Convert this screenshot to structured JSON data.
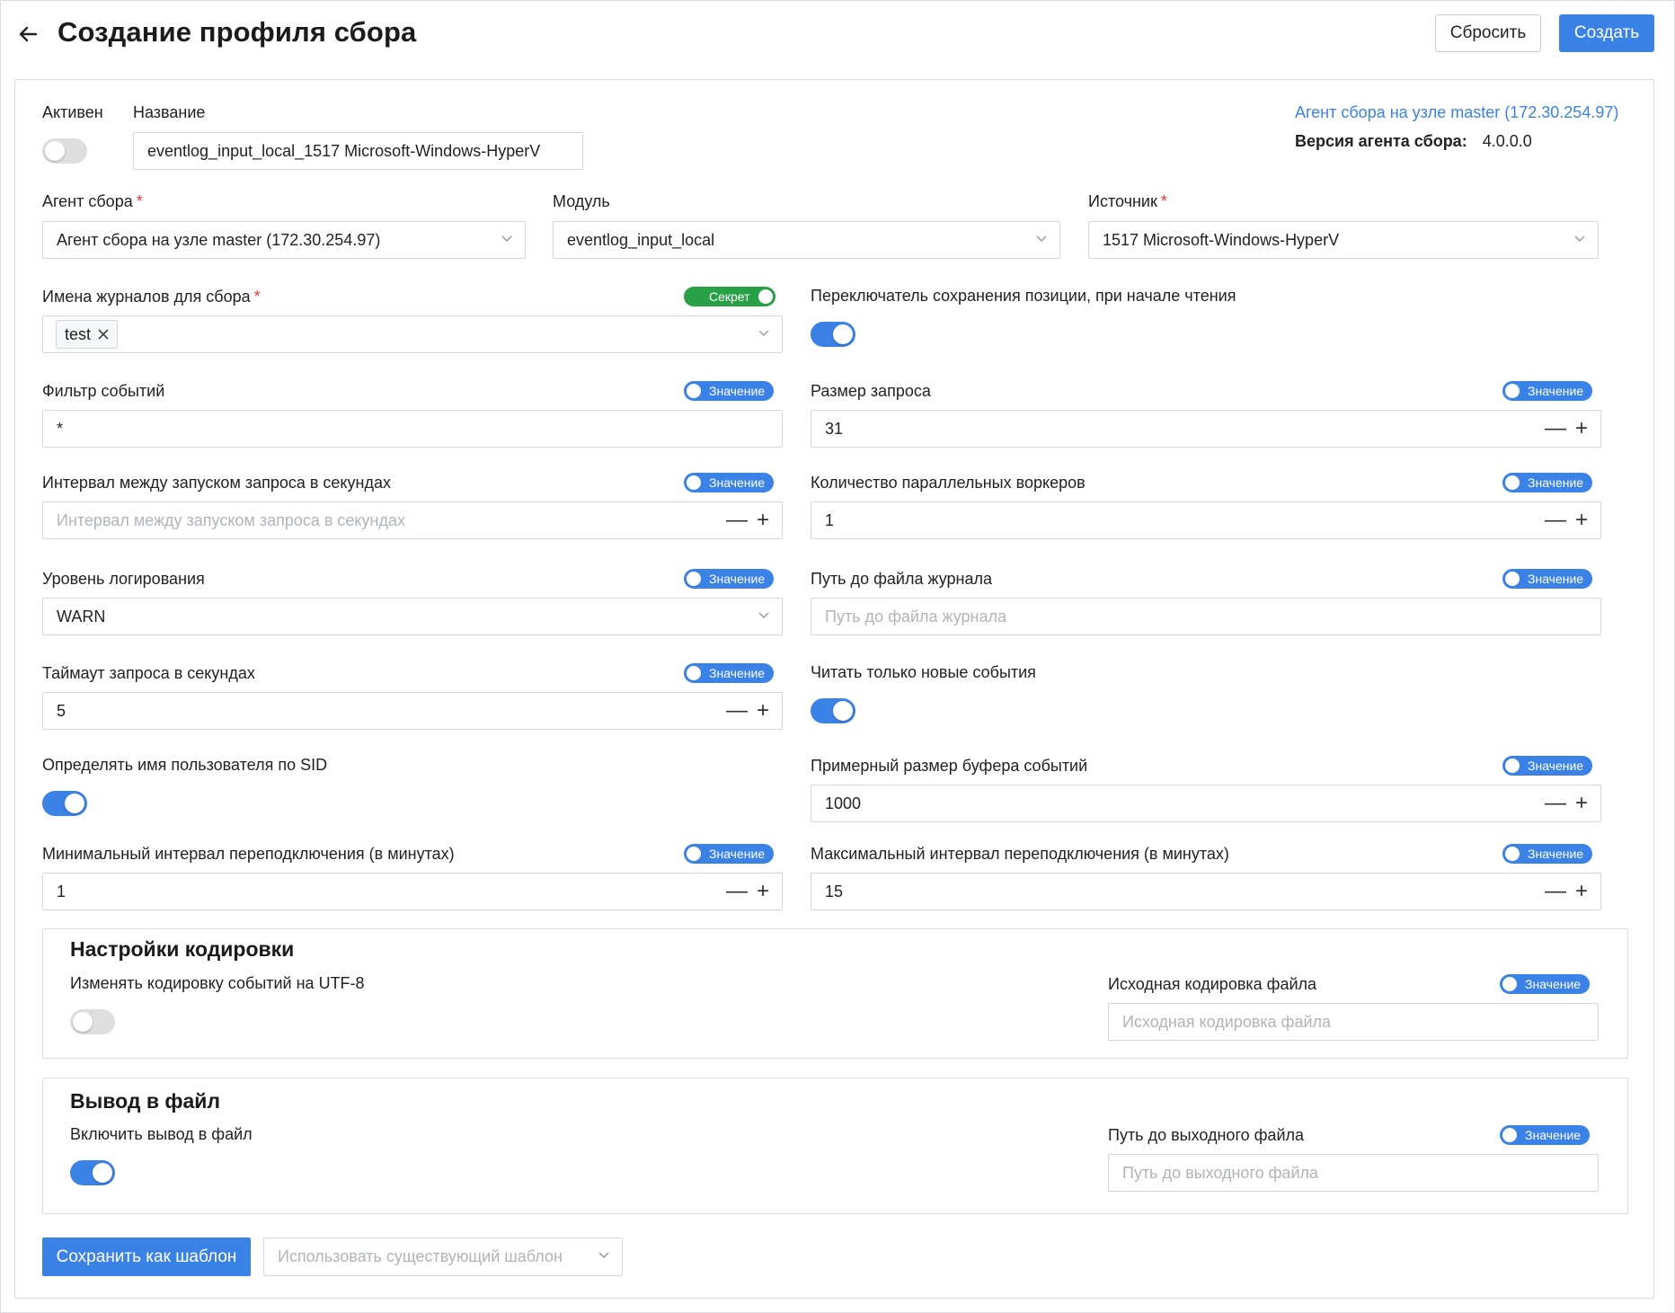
{
  "header": {
    "title": "Создание профиля сбора",
    "reset_label": "Сбросить",
    "create_label": "Создать"
  },
  "top": {
    "active_label": "Активен",
    "active_on": false,
    "name_label": "Название",
    "name_value": "eventlog_input_local_1517 Microsoft-Windows-HyperV",
    "agent_link": "Агент сбора на узле master (172.30.254.97)",
    "agent_version_label": "Версия агента сбора:",
    "agent_version_value": "4.0.0.0"
  },
  "selects": {
    "agent_label": "Агент сбора",
    "agent_value": "Агент сбора на узле master (172.30.254.97)",
    "module_label": "Модуль",
    "module_value": "eventlog_input_local",
    "source_label": "Источник",
    "source_value": "1517 Microsoft-Windows-HyperV"
  },
  "pills": {
    "value": "Значение",
    "secret": "Секрет"
  },
  "fields": {
    "journals_label": "Имена журналов для сбора",
    "journals_tag": "test",
    "save_pos_label": "Переключатель сохранения позиции, при начале чтения",
    "save_pos_on": true,
    "filter_label": "Фильтр событий",
    "filter_value": "*",
    "req_size_label": "Размер запроса",
    "req_size_value": "31",
    "interval_label": "Интервал между запуском запроса в секундах",
    "interval_placeholder": "Интервал между запуском запроса в секундах",
    "workers_label": "Количество параллельных воркеров",
    "workers_value": "1",
    "log_level_label": "Уровень логирования",
    "log_level_value": "WARN",
    "log_path_label": "Путь до файла журнала",
    "log_path_placeholder": "Путь до файла журнала",
    "timeout_label": "Таймаут запроса в секундах",
    "timeout_value": "5",
    "new_only_label": "Читать только новые события",
    "new_only_on": true,
    "sid_label": "Определять имя пользователя по SID",
    "sid_on": true,
    "buffer_label": "Примерный размер буфера событий",
    "buffer_value": "1000",
    "min_reconnect_label": "Минимальный интервал переподключения (в минутах)",
    "min_reconnect_value": "1",
    "max_reconnect_label": "Максимальный интервал переподключения (в минутах)",
    "max_reconnect_value": "15"
  },
  "encoding": {
    "title": "Настройки кодировки",
    "utf8_label": "Изменять кодировку событий на UTF-8",
    "utf8_on": false,
    "src_label": "Исходная кодировка файла",
    "src_placeholder": "Исходная кодировка файла"
  },
  "output": {
    "title": "Вывод в файл",
    "enable_label": "Включить вывод в файл",
    "enable_on": true,
    "path_label": "Путь до выходного файла",
    "path_placeholder": "Путь до выходного файла"
  },
  "footer": {
    "save_template": "Сохранить как шаблон",
    "use_template_placeholder": "Использовать существующий шаблон"
  },
  "stepper": {
    "minus": "—",
    "plus": "+"
  },
  "colors": {
    "accent": "#3b82e6",
    "secret_green": "#27a046",
    "required": "#e03a3a"
  }
}
